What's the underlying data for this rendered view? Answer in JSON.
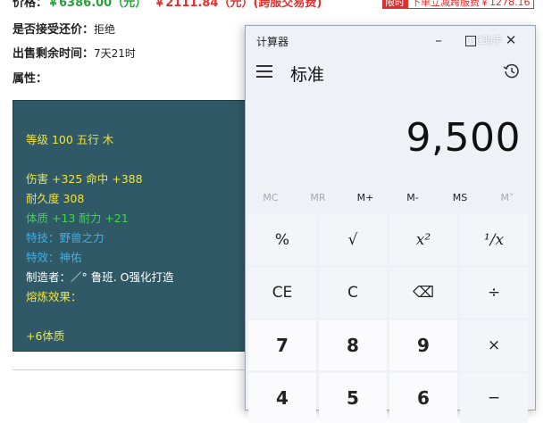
{
  "webpage": {
    "price_label": "价格：",
    "price_value": "￥6386.00（元）",
    "price_extra": "￥2111.84（元）(跨服交易费)",
    "badge_tag": "限时",
    "badge_text": "下单立减跨服费￥1278.16",
    "bargain_label": "是否接受还价：",
    "bargain_value": "拒绝",
    "time_label": "出售剩余时间：",
    "time_value": "7天21时",
    "attr_label": "属性：",
    "item": {
      "level": "等级 100 五行 木",
      "damage": "伤害 +325 命中 +388",
      "durability": "耐久度 308",
      "constitution": "体质 +13 耐力 +21",
      "skill": "特技：野兽之力",
      "effect": "特效：神佑",
      "maker": "制造者：／° 鲁班. O强化打造",
      "smelt_label": "熔炼效果：",
      "smelt_value": "+6体质"
    }
  },
  "calculator": {
    "window_title": "计算器",
    "watermark": "CC助手",
    "mode": "标准",
    "display": "9,500",
    "memory_buttons": [
      {
        "label": "MC",
        "enabled": false
      },
      {
        "label": "MR",
        "enabled": false
      },
      {
        "label": "M+",
        "enabled": true
      },
      {
        "label": "M-",
        "enabled": true
      },
      {
        "label": "MS",
        "enabled": true
      },
      {
        "label": "M˅",
        "enabled": false
      }
    ],
    "keys": {
      "percent": "%",
      "sqrt": "√",
      "square": "x²",
      "reciprocal": "¹/x",
      "clear_entry": "CE",
      "clear": "C",
      "backspace": "⌫",
      "divide": "÷",
      "seven": "7",
      "eight": "8",
      "nine": "9",
      "multiply": "×",
      "four": "4",
      "five": "5",
      "six": "6",
      "minus": "−"
    }
  }
}
